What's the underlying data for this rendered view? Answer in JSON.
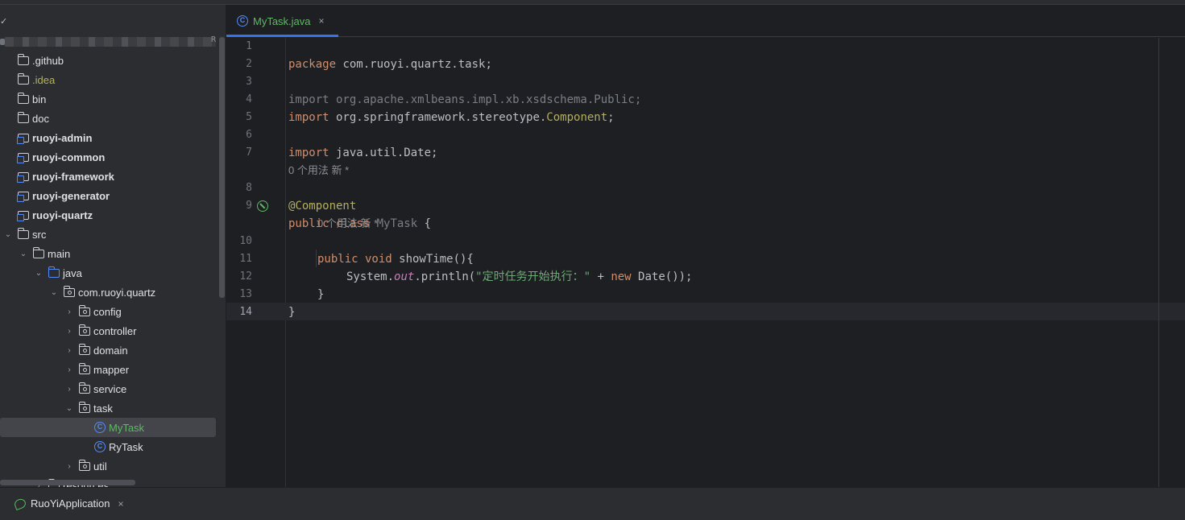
{
  "window": {
    "top_strip": ""
  },
  "project": {
    "caret": "✓",
    "root_tag": "R",
    "items": [
      {
        "label": ".github",
        "type": "folder",
        "depth": 0,
        "expanded": null,
        "style": "normal"
      },
      {
        "label": ".idea",
        "type": "folder",
        "depth": 0,
        "expanded": null,
        "style": "idea"
      },
      {
        "label": "bin",
        "type": "folder",
        "depth": 0,
        "expanded": null,
        "style": "normal"
      },
      {
        "label": "doc",
        "type": "folder",
        "depth": 0,
        "expanded": null,
        "style": "normal"
      },
      {
        "label": "ruoyi-admin",
        "type": "module",
        "depth": 0,
        "expanded": null,
        "style": "bold"
      },
      {
        "label": "ruoyi-common",
        "type": "module",
        "depth": 0,
        "expanded": null,
        "style": "bold"
      },
      {
        "label": "ruoyi-framework",
        "type": "module",
        "depth": 0,
        "expanded": null,
        "style": "bold"
      },
      {
        "label": "ruoyi-generator",
        "type": "module",
        "depth": 0,
        "expanded": null,
        "style": "bold"
      },
      {
        "label": "ruoyi-quartz",
        "type": "module",
        "depth": 0,
        "expanded": null,
        "style": "bold"
      },
      {
        "label": "src",
        "type": "folder",
        "depth": 0,
        "expanded": true,
        "style": "normal"
      },
      {
        "label": "main",
        "type": "folder",
        "depth": 1,
        "expanded": true,
        "style": "normal"
      },
      {
        "label": "java",
        "type": "src-folder",
        "depth": 2,
        "expanded": true,
        "style": "normal"
      },
      {
        "label": "com.ruoyi.quartz",
        "type": "pkg",
        "depth": 3,
        "expanded": true,
        "style": "normal"
      },
      {
        "label": "config",
        "type": "pkg",
        "depth": 4,
        "expanded": false,
        "style": "normal"
      },
      {
        "label": "controller",
        "type": "pkg",
        "depth": 4,
        "expanded": false,
        "style": "normal"
      },
      {
        "label": "domain",
        "type": "pkg",
        "depth": 4,
        "expanded": false,
        "style": "normal"
      },
      {
        "label": "mapper",
        "type": "pkg",
        "depth": 4,
        "expanded": false,
        "style": "normal"
      },
      {
        "label": "service",
        "type": "pkg",
        "depth": 4,
        "expanded": false,
        "style": "normal"
      },
      {
        "label": "task",
        "type": "pkg",
        "depth": 4,
        "expanded": true,
        "style": "normal"
      },
      {
        "label": "MyTask",
        "type": "cls",
        "depth": 5,
        "expanded": null,
        "style": "selected-green"
      },
      {
        "label": "RyTask",
        "type": "cls",
        "depth": 5,
        "expanded": null,
        "style": "normal"
      },
      {
        "label": "util",
        "type": "pkg",
        "depth": 4,
        "expanded": false,
        "style": "normal"
      },
      {
        "label": "resources",
        "type": "folder",
        "depth": 2,
        "expanded": false,
        "style": "normal"
      }
    ]
  },
  "editor": {
    "tab": {
      "label": "MyTask.java",
      "icon": "C",
      "close": "×"
    },
    "hints": {
      "usages_line1": "0 个用法  新 *",
      "usages_line2": "0 个用法  新 *"
    },
    "line_numbers": [
      "1",
      "2",
      "3",
      "4",
      "5",
      "6",
      "7",
      "8",
      "9",
      "10",
      "11",
      "12",
      "13",
      "14"
    ],
    "code": {
      "l1_kw": "package",
      "l1_rest": " com.ruoyi.quartz.task;",
      "l3": "import org.apache.xmlbeans.impl.xb.xsdschema.Public;",
      "l4_kw": "import",
      "l4_mid": " org.springframework.stereotype.",
      "l4_cls": "Component",
      "l4_end": ";",
      "l6_kw": "import",
      "l6_rest": " java.util.Date;",
      "l8": "@Component",
      "l9_kw": "public class",
      "l9_name": " MyTask",
      "l9_end": " {",
      "l10_kw": "public void",
      "l10_rest": " showTime(){",
      "l11_a": "System.",
      "l11_field": "out",
      "l11_b": ".println(",
      "l11_str": "\"定时任务开始执行：\"",
      "l11_c": " + ",
      "l11_kw": "new",
      "l11_d": " Date());",
      "l12": "}",
      "l13": "}"
    }
  },
  "bottom": {
    "run_label": "RuoYiApplication",
    "close": "×"
  },
  "colors": {
    "accent": "#3574f0",
    "green": "#5fb865",
    "keyword": "#cf8e6d",
    "annotation": "#b3ae60",
    "string": "#6aab73"
  }
}
